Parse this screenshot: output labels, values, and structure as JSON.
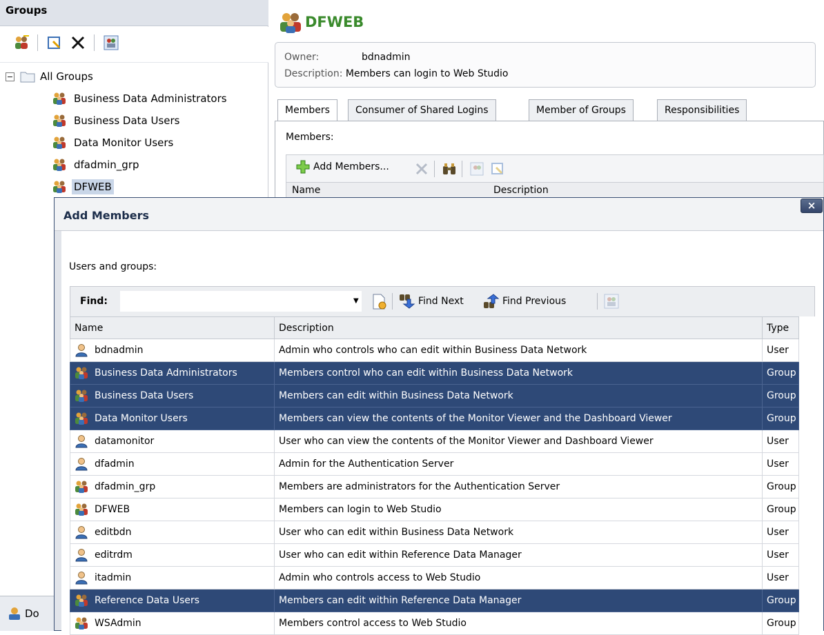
{
  "left_panel": {
    "title": "Groups",
    "tree": {
      "root_label": "All Groups",
      "items": [
        {
          "label": "Business Data Administrators"
        },
        {
          "label": "Business Data Users"
        },
        {
          "label": "Data Monitor Users"
        },
        {
          "label": "dfadmin_grp"
        },
        {
          "label": "DFWEB",
          "selected": true
        }
      ]
    },
    "bottom_tab_label": "Do"
  },
  "details": {
    "title": "DFWEB",
    "owner_label": "Owner:",
    "owner_value": "bdnadmin",
    "description_label": "Description:",
    "description_value": "Members can login to Web Studio",
    "tabs": [
      {
        "label": "Members",
        "active": true
      },
      {
        "label": "Consumer of Shared Logins"
      },
      {
        "label": "Member of Groups"
      },
      {
        "label": "Responsibilities"
      }
    ],
    "members_label": "Members:",
    "add_members_label": "Add Members...",
    "grid_columns": [
      "Name",
      "Description"
    ]
  },
  "dialog": {
    "title": "Add Members",
    "close_label": "×",
    "users_groups_label": "Users and groups:",
    "find_label": "Find:",
    "find_value": "",
    "find_next_label": "Find Next",
    "find_previous_label": "Find Previous",
    "columns": [
      "Name",
      "Description",
      "Type"
    ],
    "rows": [
      {
        "name": "bdnadmin",
        "description": "Admin who controls who can edit within Business Data Network",
        "type": "User",
        "kind": "user",
        "selected": false
      },
      {
        "name": "Business Data Administrators",
        "description": "Members control who can edit within Business Data Network",
        "type": "Group",
        "kind": "group",
        "selected": true
      },
      {
        "name": "Business Data Users",
        "description": "Members can edit within Business Data Network",
        "type": "Group",
        "kind": "group",
        "selected": true
      },
      {
        "name": "Data Monitor Users",
        "description": "Members can view the contents of the Monitor Viewer and the Dashboard Viewer",
        "type": "Group",
        "kind": "group",
        "selected": true
      },
      {
        "name": "datamonitor",
        "description": "User who can view the contents of the Monitor Viewer and Dashboard Viewer",
        "type": "User",
        "kind": "user",
        "selected": false
      },
      {
        "name": "dfadmin",
        "description": "Admin for the Authentication Server",
        "type": "User",
        "kind": "user",
        "selected": false
      },
      {
        "name": "dfadmin_grp",
        "description": "Members are administrators for the Authentication Server",
        "type": "Group",
        "kind": "group",
        "selected": false
      },
      {
        "name": "DFWEB",
        "description": "Members can login to Web Studio",
        "type": "Group",
        "kind": "group",
        "selected": false
      },
      {
        "name": "editbdn",
        "description": "User who can edit within Business Data Network",
        "type": "User",
        "kind": "user",
        "selected": false
      },
      {
        "name": "editrdm",
        "description": "User who can edit within Reference Data Manager",
        "type": "User",
        "kind": "user",
        "selected": false
      },
      {
        "name": "itadmin",
        "description": "Admin who controls access to Web Studio",
        "type": "User",
        "kind": "user",
        "selected": false
      },
      {
        "name": "Reference Data Users",
        "description": "Members can edit within Reference Data Manager",
        "type": "Group",
        "kind": "group",
        "selected": true
      },
      {
        "name": "WSAdmin",
        "description": "Members control access to Web Studio",
        "type": "Group",
        "kind": "group",
        "selected": false
      }
    ]
  },
  "colors": {
    "selection": "#2e4977",
    "title_green": "#3a8a2c",
    "panel_header": "#dfe3ea"
  }
}
